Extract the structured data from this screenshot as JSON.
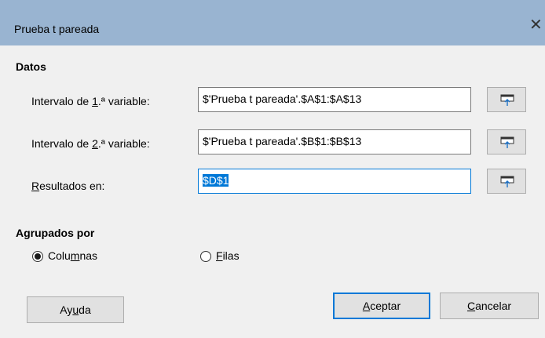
{
  "window": {
    "title": "Prueba t pareada",
    "close_glyph": "✕"
  },
  "datos": {
    "heading": "Datos",
    "var1": {
      "label_pre": "Intervalo de ",
      "label_key": "1",
      "label_post": ".ª variable:",
      "value": "$'Prueba t pareada'.$A$1:$A$13"
    },
    "var2": {
      "label_pre": "Intervalo de ",
      "label_key": "2",
      "label_post": ".ª variable:",
      "value": "$'Prueba t pareada'.$B$1:$B$13"
    },
    "results": {
      "label_key": "R",
      "label_post": "esultados en:",
      "value": "$D$1"
    },
    "shrink_icon": "shrink-range-icon"
  },
  "grouped": {
    "heading": "Agrupados por",
    "columns": {
      "pre": "Colu",
      "key": "m",
      "post": "nas",
      "checked": true
    },
    "rows": {
      "key": "F",
      "post": "ilas",
      "checked": false
    }
  },
  "buttons": {
    "help": {
      "pre": "Ay",
      "key": "u",
      "post": "da"
    },
    "ok": {
      "key": "A",
      "post": "ceptar"
    },
    "cancel": {
      "key": "C",
      "post": "ancelar"
    }
  },
  "colors": {
    "titlebar": "#99b4d1",
    "focus": "#0078d7",
    "dialog_bg": "#f0f0f0"
  }
}
